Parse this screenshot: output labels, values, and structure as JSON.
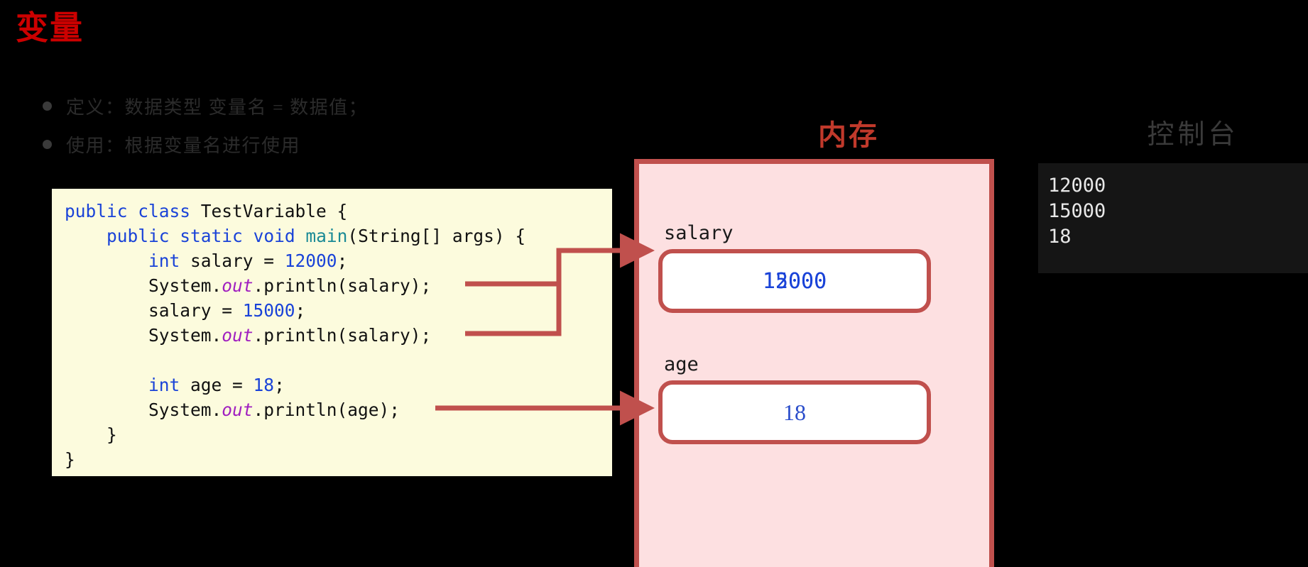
{
  "slide": {
    "title": "变量",
    "background_color": "#000000",
    "title_color": "#cc0000"
  },
  "bullets": [
    {
      "text": "定义：数据类型  变量名  =  数据值；"
    },
    {
      "text": "使用：根据变量名进行使用"
    }
  ],
  "code_panel": {
    "background_color": "#fcfbdd",
    "language": "java",
    "lines": [
      [
        {
          "t": "public",
          "c": "kw"
        },
        {
          "t": " ",
          "c": "pl"
        },
        {
          "t": "class",
          "c": "kw"
        },
        {
          "t": " TestVariable {",
          "c": "pl"
        }
      ],
      [
        {
          "t": "    ",
          "c": "pl"
        },
        {
          "t": "public",
          "c": "kw"
        },
        {
          "t": " ",
          "c": "pl"
        },
        {
          "t": "static",
          "c": "kw"
        },
        {
          "t": " ",
          "c": "pl"
        },
        {
          "t": "void",
          "c": "kw"
        },
        {
          "t": " ",
          "c": "pl"
        },
        {
          "t": "main",
          "c": "fn"
        },
        {
          "t": "(String[] args) {",
          "c": "pl"
        }
      ],
      [
        {
          "t": "        ",
          "c": "pl"
        },
        {
          "t": "int",
          "c": "kw"
        },
        {
          "t": " salary = ",
          "c": "pl"
        },
        {
          "t": "12000",
          "c": "num"
        },
        {
          "t": ";",
          "c": "pl"
        }
      ],
      [
        {
          "t": "        System.",
          "c": "pl"
        },
        {
          "t": "out",
          "c": "fld"
        },
        {
          "t": ".println(salary);",
          "c": "pl"
        }
      ],
      [
        {
          "t": "        salary = ",
          "c": "pl"
        },
        {
          "t": "15000",
          "c": "num"
        },
        {
          "t": ";",
          "c": "pl"
        }
      ],
      [
        {
          "t": "        System.",
          "c": "pl"
        },
        {
          "t": "out",
          "c": "fld"
        },
        {
          "t": ".println(salary);",
          "c": "pl"
        }
      ],
      [
        {
          "t": "",
          "c": "pl"
        }
      ],
      [
        {
          "t": "        ",
          "c": "pl"
        },
        {
          "t": "int",
          "c": "kw"
        },
        {
          "t": " age = ",
          "c": "pl"
        },
        {
          "t": "18",
          "c": "num"
        },
        {
          "t": ";",
          "c": "pl"
        }
      ],
      [
        {
          "t": "        System.",
          "c": "pl"
        },
        {
          "t": "out",
          "c": "fld"
        },
        {
          "t": ".println(age);",
          "c": "pl"
        }
      ],
      [
        {
          "t": "    }",
          "c": "pl"
        }
      ],
      [
        {
          "t": "}",
          "c": "pl"
        }
      ]
    ]
  },
  "memory": {
    "title": "内存",
    "title_color": "#c0392b",
    "panel_fill": "#fde0e1",
    "panel_border": "#c0504d",
    "variables": [
      {
        "name": "salary",
        "value": "12000",
        "value_overlay": "15000",
        "overlapping": true
      },
      {
        "name": "age",
        "value": "18",
        "value_overlay": "",
        "overlapping": false
      }
    ]
  },
  "console": {
    "title": "控制台",
    "title_color": "#3a3a3a",
    "background_color": "#151515",
    "output_lines": [
      "12000",
      "15000",
      "18"
    ]
  },
  "connectors": {
    "color": "#c0504d",
    "arrows": [
      {
        "from": "println(salary) line 1",
        "to": "salary memory slot"
      },
      {
        "from": "println(salary) line 2",
        "to": "salary memory slot"
      },
      {
        "from": "println(age)",
        "to": "age memory slot"
      }
    ]
  }
}
